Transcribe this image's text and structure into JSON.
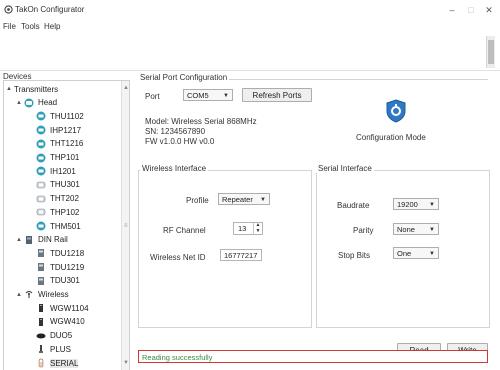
{
  "window": {
    "title": "TakOn Configurator",
    "min_glyph": "–",
    "max_glyph": "□",
    "close_glyph": "✕"
  },
  "menu": {
    "items": [
      "File",
      "Tools",
      "Help"
    ]
  },
  "devices": {
    "label": "Devices",
    "tree": [
      {
        "label": "Transmitters",
        "expander": "▲",
        "icon": "none"
      },
      {
        "label": "Head",
        "expander": "▲",
        "icon": "head-icon"
      },
      {
        "label": "THU1102",
        "expander": "",
        "icon": "transmitter-icon"
      },
      {
        "label": "IHP1217",
        "expander": "",
        "icon": "transmitter-icon"
      },
      {
        "label": "THT1216",
        "expander": "",
        "icon": "transmitter-icon"
      },
      {
        "label": "THP101",
        "expander": "",
        "icon": "transmitter-icon"
      },
      {
        "label": "IH1201",
        "expander": "",
        "icon": "transmitter-icon"
      },
      {
        "label": "THU301",
        "expander": "",
        "icon": "sensor-icon"
      },
      {
        "label": "THT202",
        "expander": "",
        "icon": "sensor-icon"
      },
      {
        "label": "THP102",
        "expander": "",
        "icon": "sensor-icon"
      },
      {
        "label": "THM501",
        "expander": "",
        "icon": "transmitter-icon"
      },
      {
        "label": "DIN Rail",
        "expander": "▲",
        "icon": "din-rail-icon"
      },
      {
        "label": "TDU1218",
        "expander": "",
        "icon": "din-device-icon"
      },
      {
        "label": "TDU1219",
        "expander": "",
        "icon": "din-device-icon"
      },
      {
        "label": "TDU301",
        "expander": "",
        "icon": "din-device-icon"
      },
      {
        "label": "Wireless",
        "expander": "▲",
        "icon": "wireless-icon"
      },
      {
        "label": "WGW1104",
        "expander": "",
        "icon": "gateway-icon"
      },
      {
        "label": "WGW410",
        "expander": "",
        "icon": "gateway-icon"
      },
      {
        "label": "DUO5",
        "expander": "",
        "icon": "duo-icon"
      },
      {
        "label": "PLUS",
        "expander": "",
        "icon": "plus-device-icon"
      },
      {
        "label": "SERIAL",
        "expander": "",
        "icon": "serial-icon"
      }
    ]
  },
  "serial_port": {
    "title": "Serial Port Configuration",
    "port_label": "Port",
    "port_value": "COM5",
    "refresh_label": "Refresh Ports",
    "model_line": "Model: Wireless Serial 868MHz",
    "sn_line": "SN: 1234567890",
    "fw_line": "FW v1.0.0  HW v0.0",
    "mode_label": "Configuration Mode"
  },
  "wireless": {
    "title": "Wireless Interface",
    "profile_label": "Profile",
    "profile_value": "Repeater",
    "rf_label": "RF Channel",
    "rf_value": "13",
    "net_label": "Wireless Net ID",
    "net_value": "16777217"
  },
  "serial_if": {
    "title": "Serial Interface",
    "baud_label": "Baudrate",
    "baud_value": "19200",
    "parity_label": "Parity",
    "parity_value": "None",
    "stop_label": "Stop Bits",
    "stop_value": "One"
  },
  "actions": {
    "read_label": "Read",
    "write_label": "Write"
  },
  "status": {
    "text": "Reading successfully"
  },
  "colors": {
    "accent_blue": "#2f78c4",
    "status_border": "#d53535",
    "status_text": "#3a8a3a"
  }
}
